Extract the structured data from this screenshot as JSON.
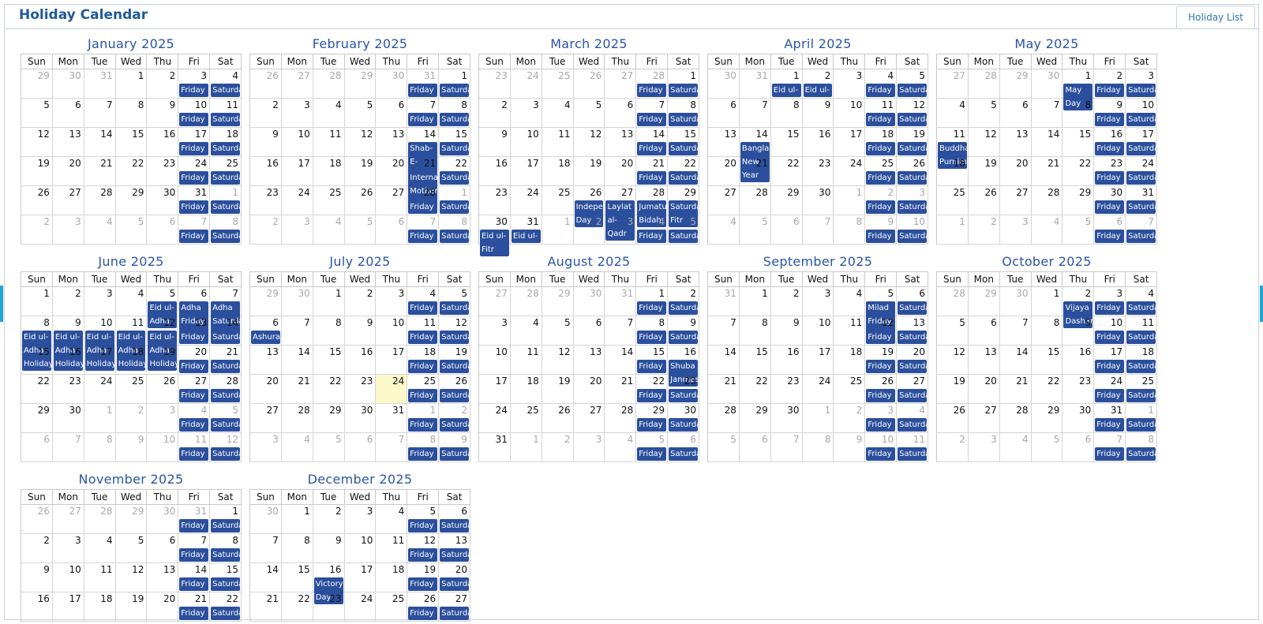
{
  "header": {
    "title": "Holiday Calendar",
    "holiday_list_label": "Holiday List"
  },
  "weekdays": [
    "Sun",
    "Mon",
    "Tue",
    "Wed",
    "Thu",
    "Fri",
    "Sat"
  ],
  "today": "2025-07-24",
  "months": [
    {
      "title": "January 2025",
      "year": 2025,
      "month": 1
    },
    {
      "title": "February 2025",
      "year": 2025,
      "month": 2
    },
    {
      "title": "March 2025",
      "year": 2025,
      "month": 3
    },
    {
      "title": "April 2025",
      "year": 2025,
      "month": 4
    },
    {
      "title": "May 2025",
      "year": 2025,
      "month": 5
    },
    {
      "title": "June 2025",
      "year": 2025,
      "month": 6
    },
    {
      "title": "July 2025",
      "year": 2025,
      "month": 7
    },
    {
      "title": "August 2025",
      "year": 2025,
      "month": 8
    },
    {
      "title": "September 2025",
      "year": 2025,
      "month": 9
    },
    {
      "title": "October 2025",
      "year": 2025,
      "month": 10
    },
    {
      "title": "November 2025",
      "year": 2025,
      "month": 11
    },
    {
      "title": "December 2025",
      "year": 2025,
      "month": 12
    }
  ],
  "weekend_labels": {
    "fri": "Friday",
    "sat": "Saturda"
  },
  "holidays": {
    "2025-02-14": "Shab-E-Barat",
    "2025-02-21": "Interna Mother Day",
    "2025-03-26": "Indepe Day",
    "2025-03-27": "Laylat al-Qadr",
    "2025-03-28": "Jumatu Bidah",
    "2025-03-29": "Saturda Fitr",
    "2025-03-31": "Eid ul-",
    "2025-04-01": "Eid ul-",
    "2025-04-02": "Eid ul-",
    "2025-03-30": "Eid ul- Fitr",
    "2025-04-01b": "Eid ul- Fitr Holiday",
    "2025-04-02b": "Eid ul- Fitr Holiday",
    "2025-04-14": "Bangla New Year",
    "2025-05-01": "May Day",
    "2025-05-11": "Buddha Purnim",
    "2025-06-05": "Eid ul- Adha",
    "2025-06-06": "Adha Friday Adha",
    "2025-06-07": "Adha Saturda Adha",
    "2025-06-08": "Eid ul- Adha Holiday",
    "2025-06-09": "Eid ul- Adha Holiday",
    "2025-06-10": "Eid ul- Adha Holiday",
    "2025-06-11": "Eid ul- Adha Holiday",
    "2025-06-12": "Eid ul- Adha Holiday",
    "2025-07-06": "Ashura",
    "2025-08-16": "Shuba Janmash",
    "2025-09-05": "Milad Friday Nabi",
    "2025-10-02": "Vijaya Dashan",
    "2025-12-16": "Victory Day"
  },
  "cells": {
    "2025-05-01": "May Day",
    "2025-09-05": "Milad Friday Nabi"
  }
}
